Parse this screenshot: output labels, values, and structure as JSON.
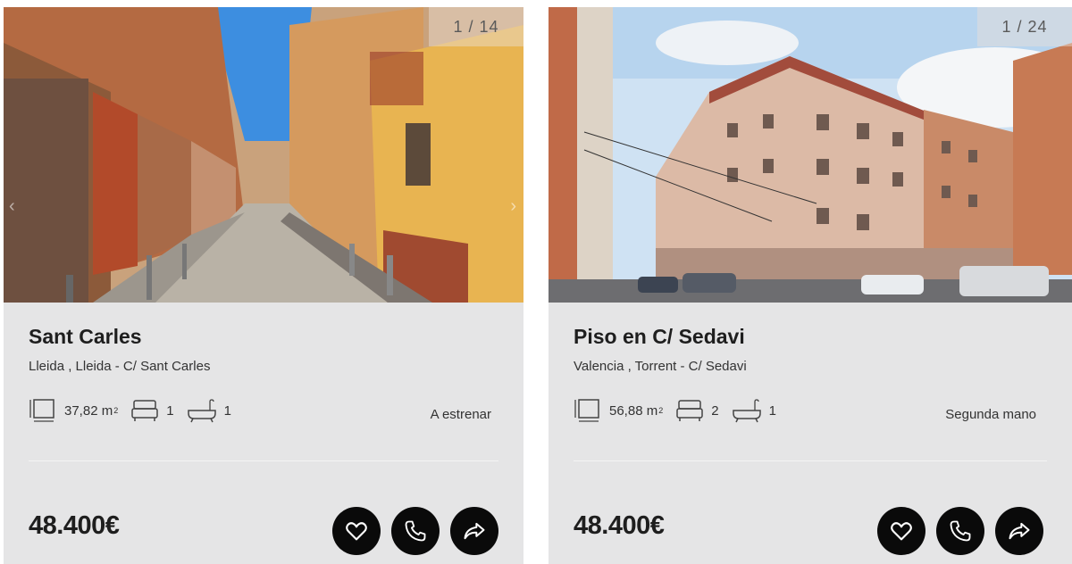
{
  "listings": [
    {
      "photo_counter": "1 / 14",
      "title": "Sant Carles",
      "location": "Lleida , Lleida - C/ Sant Carles",
      "area": "37,82 m",
      "area_unit_sup": "2",
      "bedrooms": "1",
      "bathrooms": "1",
      "condition": "A estrenar",
      "price": "48.400€"
    },
    {
      "photo_counter": "1 / 24",
      "title": "Piso en C/ Sedavi",
      "location": "Valencia , Torrent - C/ Sedavi",
      "area": "56,88 m",
      "area_unit_sup": "2",
      "bedrooms": "2",
      "bathrooms": "1",
      "condition": "Segunda mano",
      "price": "48.400€"
    }
  ],
  "icons": {
    "area": "area-icon",
    "bed": "bed-icon",
    "bath": "bathtub-icon",
    "favorite": "heart-icon",
    "call": "phone-icon",
    "share": "share-arrow-icon"
  },
  "colors": {
    "card_bg": "#e5e5e6",
    "button_bg": "#0a0a0a",
    "text": "#1e1e1e"
  }
}
